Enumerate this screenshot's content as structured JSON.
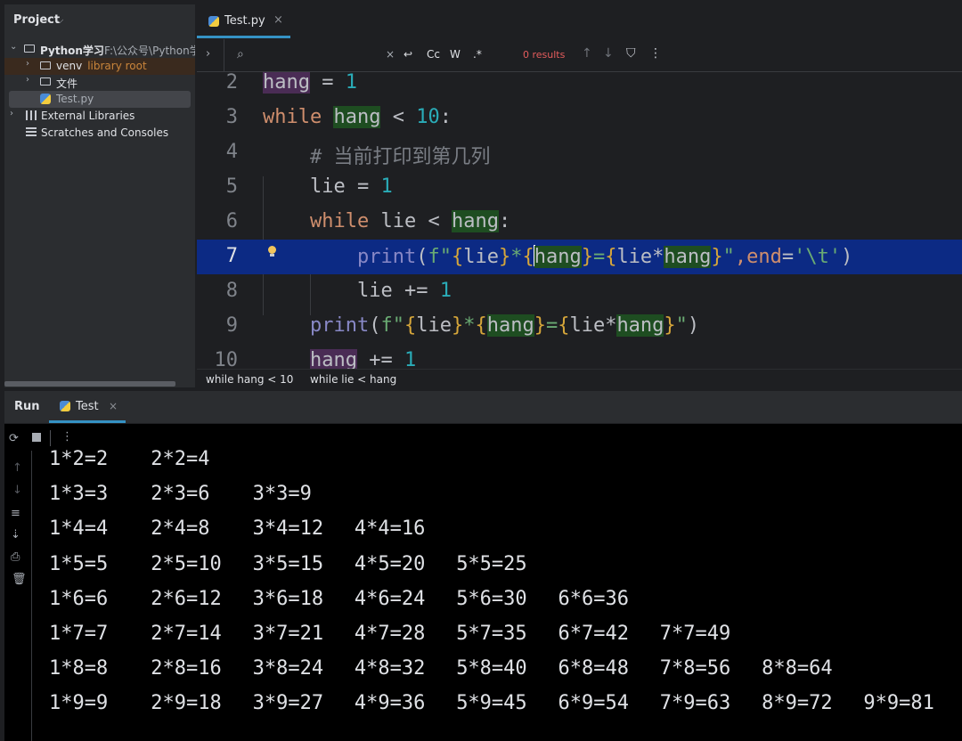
{
  "project": {
    "title": "Project",
    "root": {
      "name": "Python学习",
      "path": "F:\\公众号\\Python学"
    },
    "items": [
      {
        "label": "venv",
        "sub": "library root"
      },
      {
        "label": "文件"
      },
      {
        "label": "Test.py"
      },
      {
        "label": "External Libraries"
      },
      {
        "label": "Scratches and Consoles"
      }
    ]
  },
  "editor": {
    "tab": {
      "label": "Test.py"
    },
    "find": {
      "placeholder": "",
      "match_case": "Cc",
      "words": "W",
      "regex": ".*",
      "results": "0 results"
    },
    "line_numbers": [
      "2",
      "3",
      "4",
      "5",
      "6",
      "7",
      "8",
      "9",
      "10"
    ],
    "code": {
      "l2": {
        "var": "hang",
        "op": " = ",
        "num": "1"
      },
      "l3": {
        "kw": "while",
        "var": "hang",
        "op": " < ",
        "num": "10",
        "colon": ":"
      },
      "l4": {
        "comment": "# 当前打印到第几列"
      },
      "l5": {
        "var": "lie",
        "op": " = ",
        "num": "1"
      },
      "l6": {
        "kw": "while",
        "var": "lie",
        "op": " < ",
        "var2": "hang",
        "colon": ":"
      },
      "l7": {
        "fn": "print",
        "p1": "(",
        "f": "f\"",
        "a": "lie",
        "star": "*",
        "b": "hang",
        "eq": "=",
        "c": "lie*",
        "d": "hang",
        "q": "\"",
        "comma": ",",
        "kw": "end",
        "eq2": "=",
        "str": "'\\t'",
        "p2": ")"
      },
      "l8": {
        "var": "lie",
        "op": " += ",
        "num": "1"
      },
      "l9": {
        "fn": "print",
        "p1": "(",
        "f": "f\"",
        "a": "lie",
        "star": "*",
        "b": "hang",
        "eq": "=",
        "c": "lie*",
        "d": "hang",
        "q": "\"",
        "p2": ")"
      },
      "l10": {
        "var": "hang",
        "op": " += ",
        "num": "1"
      }
    },
    "breadcrumbs": [
      "while hang < 10",
      "while lie < hang"
    ]
  },
  "run": {
    "title": "Run",
    "tab": "Test",
    "output": [
      [
        "1*2=2",
        "2*2=4"
      ],
      [
        "1*3=3",
        "2*3=6",
        "3*3=9"
      ],
      [
        "1*4=4",
        "2*4=8",
        "3*4=12",
        "4*4=16"
      ],
      [
        "1*5=5",
        "2*5=10",
        "3*5=15",
        "4*5=20",
        "5*5=25"
      ],
      [
        "1*6=6",
        "2*6=12",
        "3*6=18",
        "4*6=24",
        "5*6=30",
        "6*6=36"
      ],
      [
        "1*7=7",
        "2*7=14",
        "3*7=21",
        "4*7=28",
        "5*7=35",
        "6*7=42",
        "7*7=49"
      ],
      [
        "1*8=8",
        "2*8=16",
        "3*8=24",
        "4*8=32",
        "5*8=40",
        "6*8=48",
        "7*8=56",
        "8*8=64"
      ],
      [
        "1*9=9",
        "2*9=18",
        "3*9=27",
        "4*9=36",
        "5*9=45",
        "6*9=54",
        "7*9=63",
        "8*9=72",
        "9*9=81"
      ]
    ]
  },
  "colors": {
    "current_line": "#0c2a84",
    "accent": "#3592c4",
    "keyword": "#cf8e6d",
    "number": "#2aacb8"
  }
}
